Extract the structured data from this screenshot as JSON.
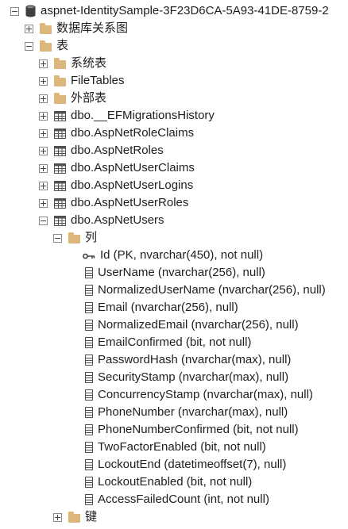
{
  "tree": {
    "database": "aspnet-IdentitySample-3F23D6CA-5A93-41DE-8759-2",
    "diagrams_folder": "数据库关系图",
    "tables_folder": "表",
    "system_tables_folder": "系统表",
    "filetables_folder": "FileTables",
    "external_tables_folder": "外部表",
    "tables": [
      "dbo.__EFMigrationsHistory",
      "dbo.AspNetRoleClaims",
      "dbo.AspNetRoles",
      "dbo.AspNetUserClaims",
      "dbo.AspNetUserLogins",
      "dbo.AspNetUserRoles",
      "dbo.AspNetUsers"
    ],
    "columns_folder": "列",
    "columns": [
      {
        "label": "Id (PK, nvarchar(450), not null)",
        "icon": "key-icon"
      },
      {
        "label": "UserName (nvarchar(256), null)",
        "icon": "column-icon"
      },
      {
        "label": "NormalizedUserName (nvarchar(256), null)",
        "icon": "column-icon"
      },
      {
        "label": "Email (nvarchar(256), null)",
        "icon": "column-icon"
      },
      {
        "label": "NormalizedEmail (nvarchar(256), null)",
        "icon": "column-icon"
      },
      {
        "label": "EmailConfirmed (bit, not null)",
        "icon": "column-icon"
      },
      {
        "label": "PasswordHash (nvarchar(max), null)",
        "icon": "column-icon"
      },
      {
        "label": "SecurityStamp (nvarchar(max), null)",
        "icon": "column-icon"
      },
      {
        "label": "ConcurrencyStamp (nvarchar(max), null)",
        "icon": "column-icon"
      },
      {
        "label": "PhoneNumber (nvarchar(max), null)",
        "icon": "column-icon"
      },
      {
        "label": "PhoneNumberConfirmed (bit, not null)",
        "icon": "column-icon"
      },
      {
        "label": "TwoFactorEnabled (bit, not null)",
        "icon": "column-icon"
      },
      {
        "label": "LockoutEnd (datetimeoffset(7), null)",
        "icon": "column-icon"
      },
      {
        "label": "LockoutEnabled (bit, not null)",
        "icon": "column-icon"
      },
      {
        "label": "AccessFailedCount (int, not null)",
        "icon": "column-icon"
      }
    ],
    "keys_folder": "键"
  }
}
